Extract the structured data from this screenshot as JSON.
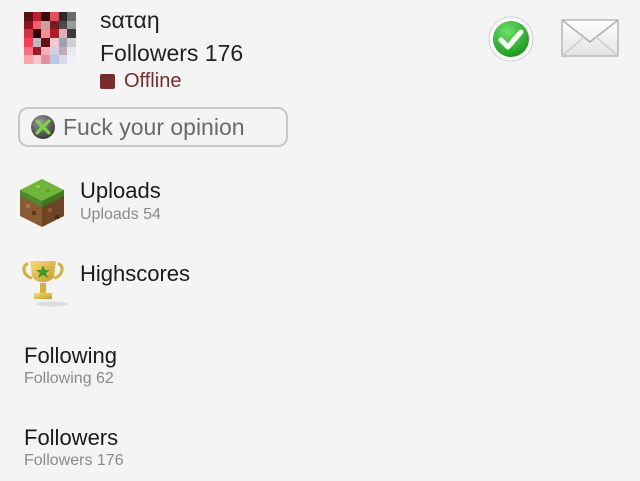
{
  "profile": {
    "username": "sαταη",
    "followers_label": "Followers 176",
    "status": "Offline",
    "status_color": "#7a2a2a",
    "avatar_icon": "pixelated-avatar",
    "motto": "Fuck your opinion",
    "motto_icon": "xbox-icon"
  },
  "actions": {
    "confirm_icon": "green-checkmark-icon",
    "message_icon": "envelope-icon"
  },
  "menu": {
    "uploads": {
      "title": "Uploads",
      "subtitle": "Uploads 54",
      "icon": "grass-block-icon"
    },
    "highscores": {
      "title": "Highscores",
      "icon": "trophy-icon"
    },
    "following": {
      "title": "Following",
      "subtitle": "Following 62"
    },
    "followers": {
      "title": "Followers",
      "subtitle": "Followers 176"
    }
  }
}
